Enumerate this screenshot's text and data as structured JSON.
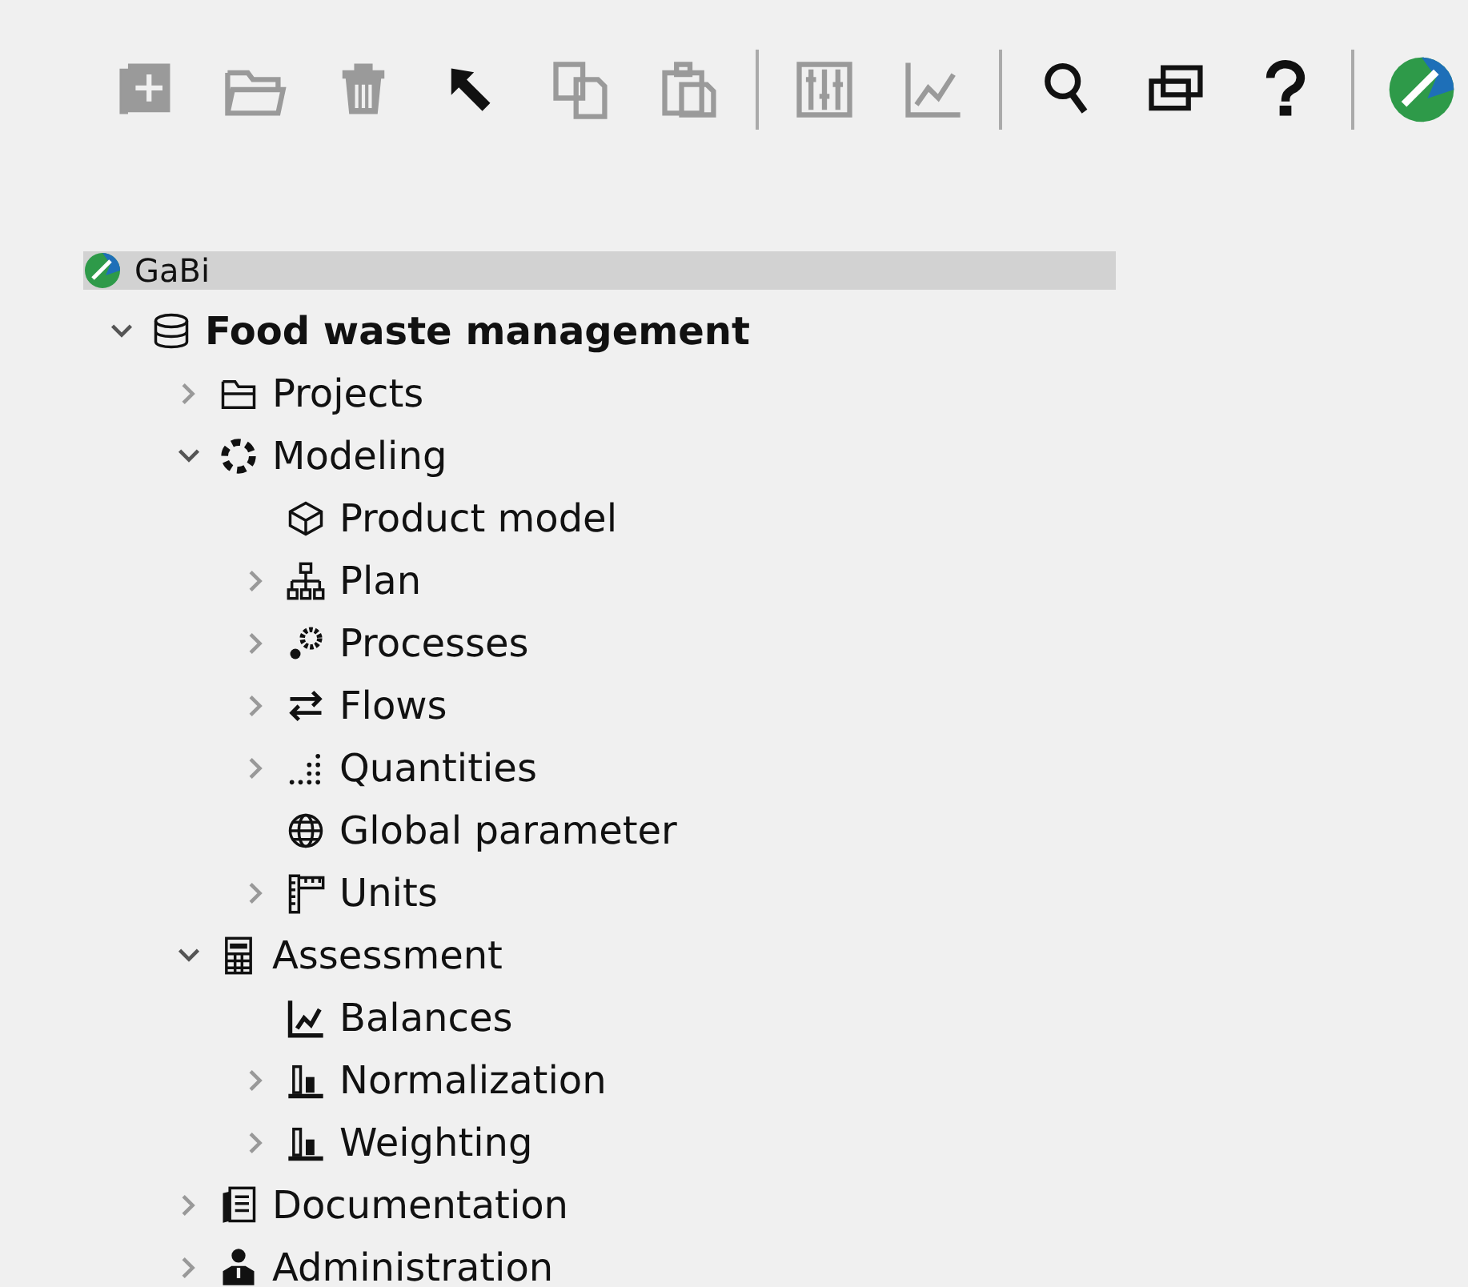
{
  "toolbar": [
    {
      "kind": "new-database",
      "disabled": true
    },
    {
      "kind": "open-folder",
      "disabled": true
    },
    {
      "kind": "trash",
      "disabled": true
    },
    {
      "kind": "pointer",
      "disabled": false
    },
    {
      "kind": "copy",
      "disabled": true
    },
    {
      "kind": "paste",
      "disabled": true
    },
    {
      "kind": "separator"
    },
    {
      "kind": "mixer",
      "disabled": true
    },
    {
      "kind": "chart",
      "disabled": true
    },
    {
      "kind": "separator"
    },
    {
      "kind": "search",
      "disabled": false
    },
    {
      "kind": "windows",
      "disabled": false
    },
    {
      "kind": "help",
      "disabled": false
    },
    {
      "kind": "separator"
    },
    {
      "kind": "logo"
    }
  ],
  "tree": {
    "label": "GaBi",
    "kind": "logo",
    "selected": true,
    "bold": false,
    "children": [
      {
        "label": "Food waste management",
        "kind": "database",
        "selected": false,
        "bold": true,
        "expanded": true,
        "children": [
          {
            "label": "Projects",
            "kind": "folder",
            "selected": false,
            "bold": false,
            "expanded": false
          },
          {
            "label": "Modeling",
            "kind": "ring",
            "selected": false,
            "bold": false,
            "expanded": true,
            "children": [
              {
                "label": "Product model",
                "kind": "cube",
                "selected": false,
                "bold": false
              },
              {
                "label": "Plan",
                "kind": "hierarchy",
                "selected": false,
                "bold": false,
                "expanded": false
              },
              {
                "label": "Processes",
                "kind": "gears",
                "selected": false,
                "bold": false,
                "expanded": false
              },
              {
                "label": "Flows",
                "kind": "arrows",
                "selected": false,
                "bold": false,
                "expanded": false
              },
              {
                "label": "Quantities",
                "kind": "dots",
                "selected": false,
                "bold": false,
                "expanded": false
              },
              {
                "label": "Global parameter",
                "kind": "globe",
                "selected": false,
                "bold": false
              },
              {
                "label": "Units",
                "kind": "ruler",
                "selected": false,
                "bold": false,
                "expanded": false
              }
            ]
          },
          {
            "label": "Assessment",
            "kind": "calculator",
            "selected": false,
            "bold": false,
            "expanded": true,
            "children": [
              {
                "label": "Balances",
                "kind": "linechart",
                "selected": false,
                "bold": false
              },
              {
                "label": "Normalization",
                "kind": "barchart",
                "selected": false,
                "bold": false,
                "expanded": false
              },
              {
                "label": "Weighting",
                "kind": "barchart",
                "selected": false,
                "bold": false,
                "expanded": false
              }
            ]
          },
          {
            "label": "Documentation",
            "kind": "documents",
            "selected": false,
            "bold": false,
            "expanded": false
          },
          {
            "label": "Administration",
            "kind": "person",
            "selected": false,
            "bold": false,
            "expanded": false
          }
        ]
      }
    ]
  }
}
